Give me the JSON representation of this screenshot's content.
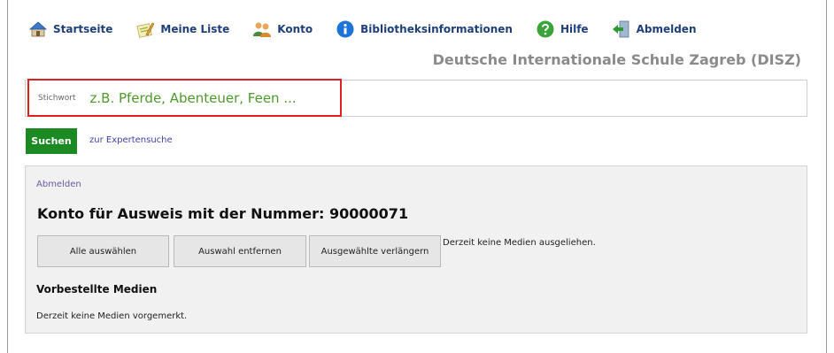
{
  "nav": {
    "items": [
      {
        "label": "Startseite",
        "icon": "home-icon"
      },
      {
        "label": "Meine Liste",
        "icon": "edit-list-icon"
      },
      {
        "label": "Konto",
        "icon": "users-icon"
      },
      {
        "label": "Bibliotheksinformationen",
        "icon": "info-icon"
      },
      {
        "label": "Hilfe",
        "icon": "help-icon"
      },
      {
        "label": "Abmelden",
        "icon": "logout-icon"
      }
    ]
  },
  "school_name": "Deutsche Internationale Schule Zagreb (DISZ)",
  "search": {
    "label": "Stichwort",
    "placeholder": "z.B. Pferde, Abenteuer, Feen ...",
    "value": "",
    "submit_label": "Suchen",
    "expert_link": "zur Expertensuche"
  },
  "account": {
    "logout_link": "Abmelden",
    "title": "Konto für Ausweis mit der Nummer: 90000071",
    "buttons": {
      "select_all": "Alle auswählen",
      "clear_selection": "Auswahl entfernen",
      "renew_selected": "Ausgewählte verlängern"
    },
    "no_loans_text": "Derzeit keine Medien ausgeliehen.",
    "reserved_heading": "Vorbestellte Medien",
    "no_reserved_text": "Derzeit keine Medien vorgemerkt."
  },
  "colors": {
    "nav_text": "#1f3f7a",
    "search_button": "#1b8a22",
    "placeholder": "#4f9a2c",
    "highlight_border": "#e0201f",
    "panel_bg": "#f1f1f1"
  }
}
